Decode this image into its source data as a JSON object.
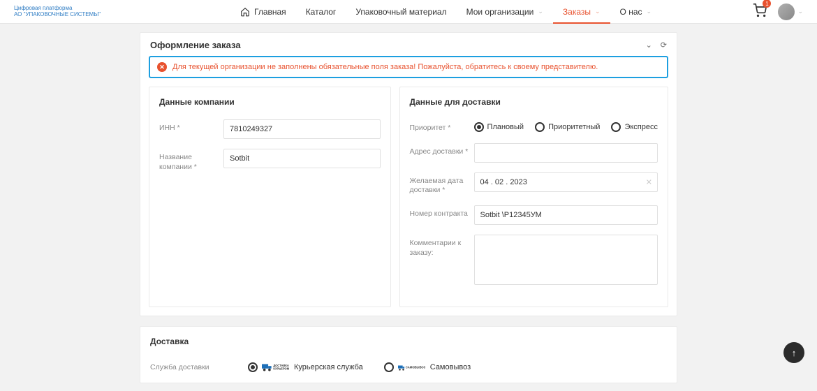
{
  "logo": {
    "line1": "Цифровая платформа",
    "line2": "АО \"УПАКОВОЧНЫЕ СИСТЕМЫ\""
  },
  "nav": {
    "home": "Главная",
    "catalog": "Каталог",
    "packaging": "Упаковочный материал",
    "orgs": "Мои организации",
    "orders": "Заказы",
    "about": "О нас"
  },
  "cart": {
    "badge": "1"
  },
  "card": {
    "title": "Оформление заказа",
    "alert": "Для текущей организации не заполнены обязательные поля заказа! Пожалуйста, обратитесь к своему представителю."
  },
  "company": {
    "heading": "Данные компании",
    "inn_label": "ИНН *",
    "inn_value": "7810249327",
    "name_label": "Название компании *",
    "name_value": "Sotbit"
  },
  "delivery_data": {
    "heading": "Данные для доставки",
    "priority_label": "Приоритет *",
    "priority_opts": {
      "planned": "Плановый",
      "priority": "Приоритетный",
      "express": "Экспресс"
    },
    "address_label": "Адрес доставки *",
    "address_value": "",
    "date_label": "Желаемая дата доставки *",
    "date_value": "04 . 02 . 2023",
    "contract_label": "Номер контракта",
    "contract_value": "Sotbit \\Р12345УМ",
    "comment_label": "Комментарии к заказу:",
    "comment_value": ""
  },
  "delivery": {
    "heading": "Доставка",
    "service_label": "Служба доставки",
    "courier": "Курьерская служба",
    "pickup": "Самовывоз",
    "courier_badge_line1": "ДОСТАВКА",
    "courier_badge_line2": "КУРЬЕРОМ",
    "pickup_badge": "САМОВЫВОЗ"
  }
}
